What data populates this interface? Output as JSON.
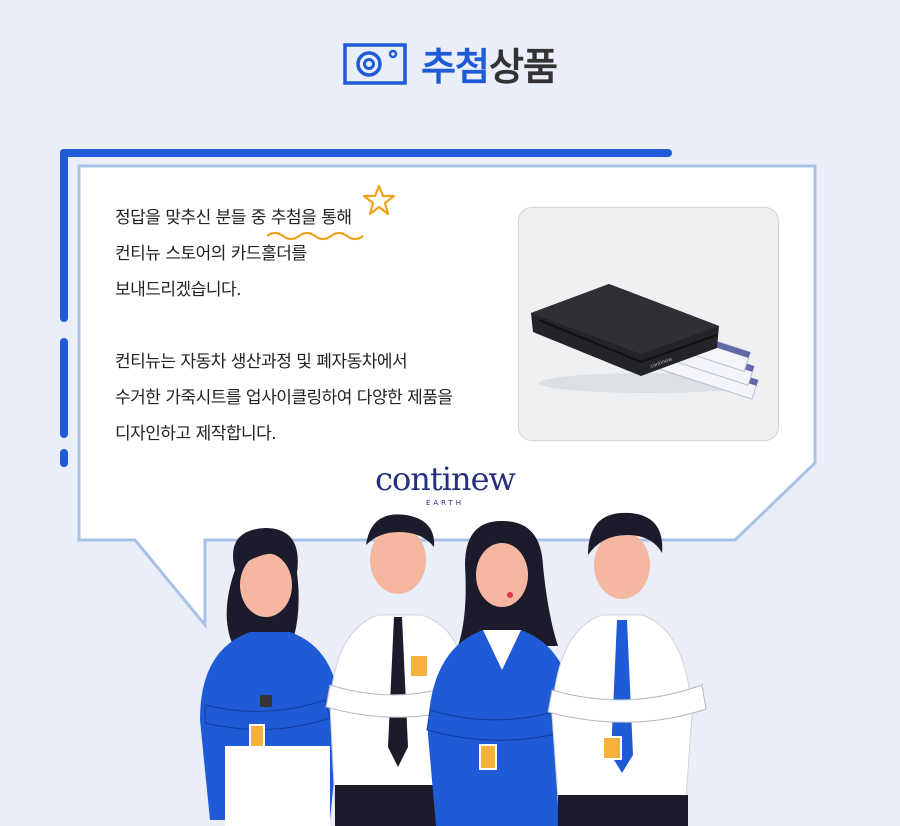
{
  "header": {
    "icon": "camera-icon",
    "title_highlight": "추첨",
    "title_rest": "상품"
  },
  "content": {
    "lines_1": [
      "정답을 맞추신 분들 중 ",
      "추첨을 통해",
      "컨티뉴 스토어의 카드홀더를",
      "보내드리겠습니다."
    ],
    "lines_2": [
      "컨티뉴는 자동차 생산과정 및 폐자동차에서",
      "수거한 가죽시트를 업사이클링하여 다양한 제품을",
      "디자인하고 제작합니다."
    ]
  },
  "product": {
    "image": "card-holder-photo",
    "engraving": "continew"
  },
  "brand": {
    "wordmark": "continew",
    "sub": "EARTH"
  },
  "colors": {
    "accent": "#1f5bd6",
    "bubble_border": "#aac1e6",
    "brand": "#26307e",
    "background": "#e9eef8"
  }
}
